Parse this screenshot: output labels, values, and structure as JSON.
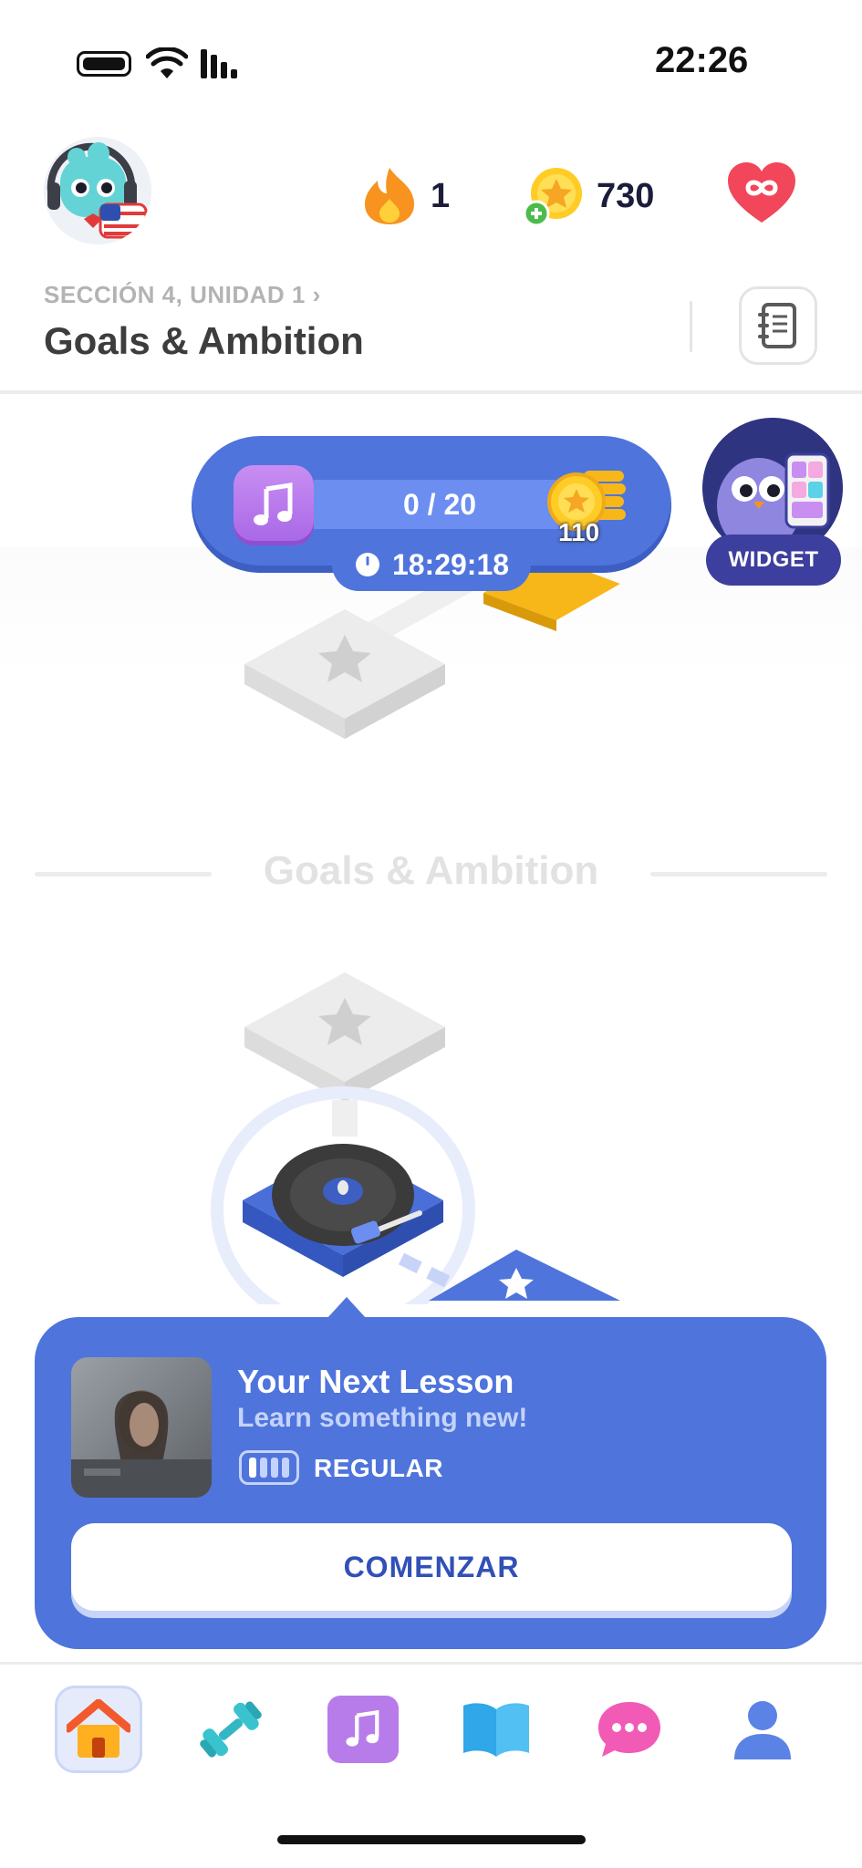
{
  "status_bar": {
    "time": "22:26"
  },
  "header": {
    "streak_count": "1",
    "coins_count": "730",
    "section_label": "SECCIÓN 4, UNIDAD 1 ›",
    "unit_title": "Goals & Ambition"
  },
  "music_challenge": {
    "progress": "0 / 20",
    "timer": "18:29:18",
    "reward": "110"
  },
  "widget": {
    "label": "WIDGET"
  },
  "unit_divider": {
    "title": "Goals & Ambition"
  },
  "lesson_card": {
    "title": "Your Next Lesson",
    "subtitle": "Learn something new!",
    "level": "REGULAR",
    "start_label": "COMENZAR"
  },
  "tabbar": {
    "items": [
      "home-icon",
      "dumbbell-icon",
      "music-icon",
      "book-icon",
      "chat-icon",
      "profile-icon"
    ],
    "active": "home-icon"
  },
  "colors": {
    "accent": "#4f74dc",
    "streak": "#f7931e",
    "heart": "#f2465a",
    "music": "#b77cea"
  }
}
